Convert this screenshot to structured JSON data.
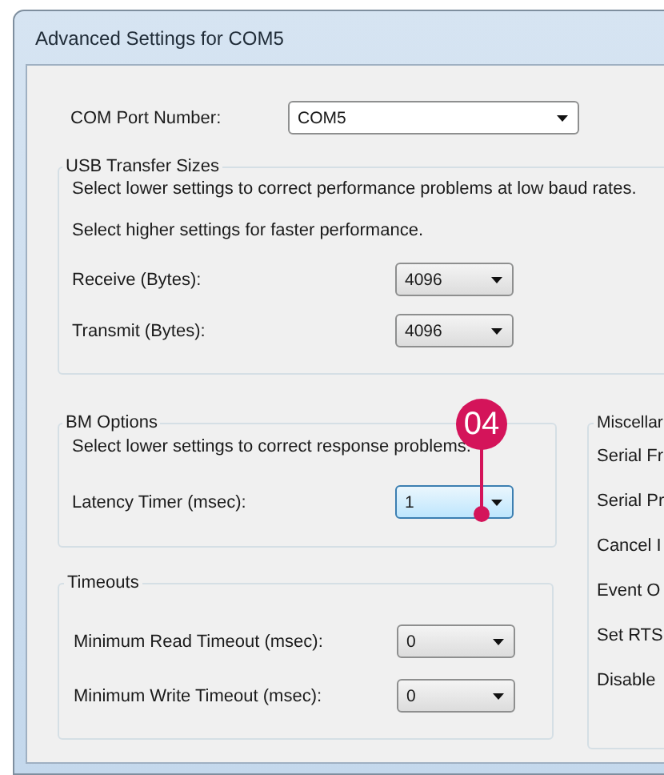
{
  "window": {
    "title": "Advanced Settings for COM5"
  },
  "com_port": {
    "label": "COM Port Number:",
    "value": "COM5",
    "focused": false
  },
  "usb_transfer_sizes": {
    "title": "USB Transfer Sizes",
    "notes": [
      "Select lower settings to correct performance problems at low baud rates.",
      "Select higher settings for faster performance."
    ],
    "fields": [
      {
        "label": "Receive (Bytes):",
        "value": "4096",
        "focused": false
      },
      {
        "label": "Transmit (Bytes):",
        "value": "4096",
        "focused": false
      }
    ]
  },
  "bm_options": {
    "title": "BM Options",
    "note": "Select lower settings to correct response problems.",
    "fields": [
      {
        "label": "Latency Timer (msec):",
        "value": "1",
        "focused": true
      }
    ]
  },
  "timeouts": {
    "title": "Timeouts",
    "fields": [
      {
        "label": "Minimum Read Timeout (msec):",
        "value": "0",
        "focused": false
      },
      {
        "label": "Minimum Write Timeout (msec):",
        "value": "0",
        "focused": false
      }
    ]
  },
  "miscellaneous": {
    "title": "Miscellar",
    "items": [
      "Serial Fr",
      "Serial Pr",
      "Cancel I",
      "Event O",
      "Set RTS",
      "Disable"
    ]
  },
  "callout": {
    "label": "04"
  }
}
